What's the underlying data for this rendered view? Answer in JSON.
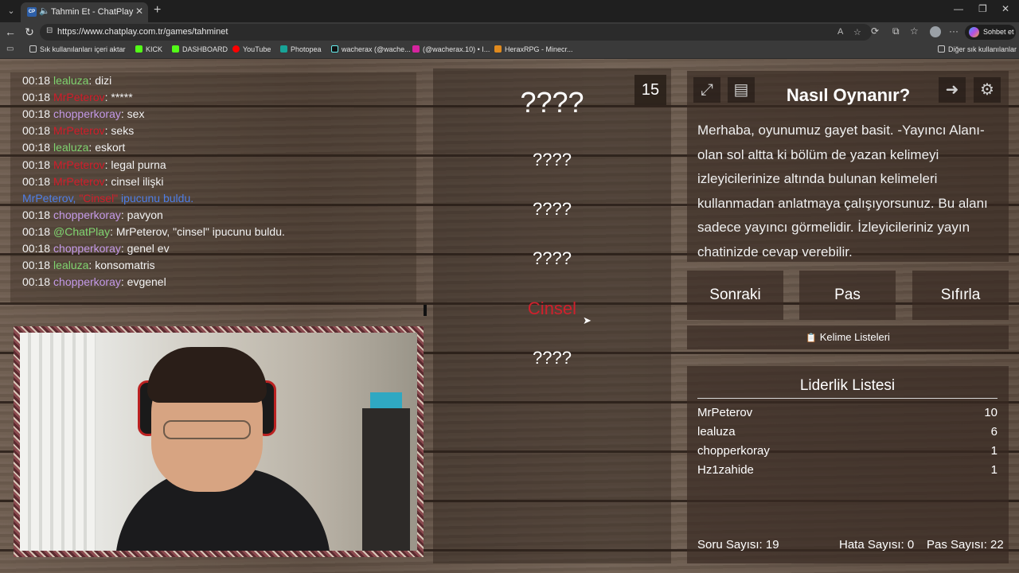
{
  "browser": {
    "tab_title": "Tahmin Et - ChatPlay",
    "tab_favicon": "CP",
    "url": "https://www.chatplay.com.tr/games/tahminet",
    "copilot_label": "Sohbet et",
    "bookmarks": [
      {
        "label": "Sık kullanılanları içeri aktar",
        "icon": "folder-icon",
        "color": "#cccccc"
      },
      {
        "label": "KICK",
        "icon": "kick-icon",
        "color": "#53fc18"
      },
      {
        "label": "DASHBOARD",
        "icon": "kick-icon",
        "color": "#53fc18"
      },
      {
        "label": "YouTube",
        "icon": "youtube-icon",
        "color": "#ff0000"
      },
      {
        "label": "Photopea",
        "icon": "photopea-icon",
        "color": "#18a497"
      },
      {
        "label": "wacherax (@wache...",
        "icon": "tiktok-icon",
        "color": "#111111"
      },
      {
        "label": "(@wacherax.10) • I...",
        "icon": "instagram-icon",
        "color": "#d6249f"
      },
      {
        "label": "HeraxRPG - Minecr...",
        "icon": "herax-icon",
        "color": "#e08a1e"
      }
    ],
    "other_bookmarks": "Diğer sık kullanılanlar"
  },
  "chat": {
    "messages": [
      {
        "time": "00:18",
        "user": "lealuza",
        "user_class": "u-lea",
        "text": ": dizi"
      },
      {
        "time": "00:18",
        "user": "MrPeterov",
        "user_class": "u-mr",
        "text": ": *****"
      },
      {
        "time": "00:18",
        "user": "chopperkoray",
        "user_class": "u-chop",
        "text": ": sex"
      },
      {
        "time": "00:18",
        "user": "MrPeterov",
        "user_class": "u-mr",
        "text": ": seks"
      },
      {
        "time": "00:18",
        "user": "lealuza",
        "user_class": "u-lea",
        "text": ": eskort"
      },
      {
        "time": "00:18",
        "user": "MrPeterov",
        "user_class": "u-mr",
        "text": ": legal purna"
      },
      {
        "time": "00:18",
        "user": "MrPeterov",
        "user_class": "u-mr",
        "text": ": cinsel ilişki"
      },
      {
        "system": true,
        "prefix": "MrPeterov, ",
        "word": "\"Cinsel\"",
        "suffix": " ipucunu buldu."
      },
      {
        "time": "00:18",
        "user": "chopperkoray",
        "user_class": "u-chop",
        "text": ": pavyon"
      },
      {
        "time": "00:18",
        "user": "@ChatPlay",
        "user_class": "u-cp",
        "text": ": MrPeterov, \"cinsel\" ipucunu buldu."
      },
      {
        "time": "00:18",
        "user": "chopperkoray",
        "user_class": "u-chop",
        "text": ": genel ev"
      },
      {
        "time": "00:18",
        "user": "lealuza",
        "user_class": "u-lea",
        "text": ": konsomatris"
      },
      {
        "time": "00:18",
        "user": "chopperkoray",
        "user_class": "u-chop",
        "text": ": evgenel"
      }
    ]
  },
  "game": {
    "timer": "15",
    "main_word": "????",
    "hints": [
      "????",
      "????",
      "????",
      "Cinsel",
      "????"
    ],
    "found_hint_index": 3
  },
  "howto": {
    "title": "Nasıl Oynanır?",
    "text": "Merhaba, oyunumuz gayet basit. -Yayıncı Alanı- olan sol altta ki bölüm de yazan kelimeyi izleyicilerinize altında bulunan kelimeleri kullanmadan anlatmaya çalışıyorsunuz. Bu alanı sadece yayıncı görmelidir. İzleyicileriniz yayın chatinizde cevap verebilir."
  },
  "controls": {
    "next": "Sonraki",
    "pass": "Pas",
    "reset": "Sıfırla",
    "word_lists": "Kelime Listeleri"
  },
  "leaderboard": {
    "title": "Liderlik Listesi",
    "rows": [
      {
        "name": "MrPeterov",
        "score": "10"
      },
      {
        "name": "lealuza",
        "score": "6"
      },
      {
        "name": "chopperkoray",
        "score": "1"
      },
      {
        "name": "Hz1zahide",
        "score": "1"
      }
    ],
    "question_count": "Soru Sayısı: 19",
    "error_count": "Hata Sayısı: 0",
    "pass_count": "Pas Sayısı: 22"
  },
  "colors": {
    "found_hint": "#d0202c",
    "system_message": "#4e7ee6"
  }
}
